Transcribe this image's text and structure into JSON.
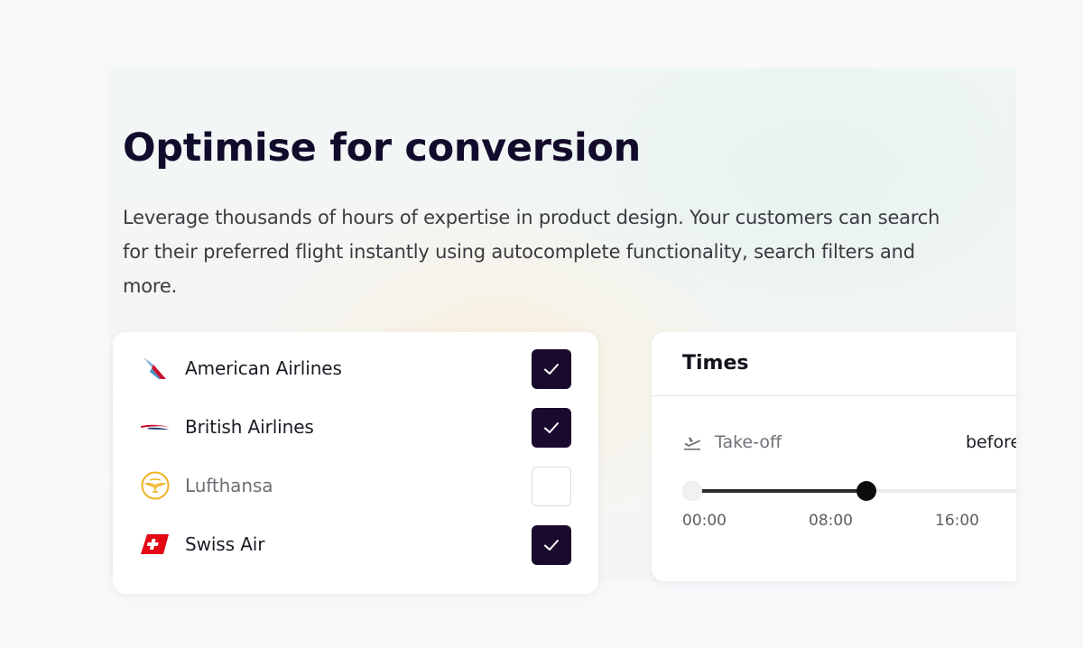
{
  "headline": "Optimise for conversion",
  "description": "Leverage thousands of hours of expertise in product design. Your customers can search for their preferred flight instantly using autocomplete functionality, search filters and more.",
  "airlines": [
    {
      "name": "American Airlines",
      "checked": true,
      "logo": "american-airlines-logo"
    },
    {
      "name": "British Airlines",
      "checked": true,
      "logo": "british-airways-logo"
    },
    {
      "name": "Lufthansa",
      "checked": false,
      "logo": "lufthansa-logo"
    },
    {
      "name": "Swiss Air",
      "checked": true,
      "logo": "swiss-air-logo"
    }
  ],
  "times": {
    "title": "Times",
    "takeoff_label": "Take-off",
    "takeoff_value": "before",
    "slider": {
      "min_hours": 0,
      "selected_max_hours": 11,
      "range_max_hours": 24
    },
    "ticks": [
      "00:00",
      "08:00",
      "16:00"
    ]
  },
  "colors": {
    "checkbox_checked": "#1a0b2e",
    "headline": "#120b2c"
  }
}
